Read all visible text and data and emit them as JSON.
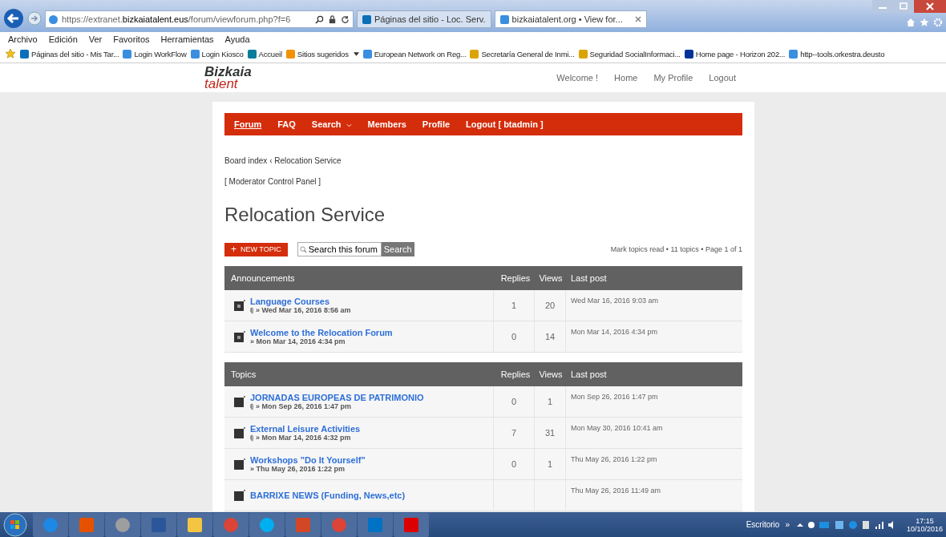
{
  "browser": {
    "address": "https://extranet.**bizkaiatalent.eus**/forum/viewforum.php?f=6",
    "tabs": [
      {
        "title": "Páginas del sitio - Loc. Serv.",
        "selected": false,
        "kind": "sharepoint"
      },
      {
        "title": "bizkaiatalent.org • View for...",
        "selected": true,
        "kind": "ie"
      }
    ],
    "menu": [
      "Archivo",
      "Edición",
      "Ver",
      "Favoritos",
      "Herramientas",
      "Ayuda"
    ],
    "favorites": [
      {
        "label": "Páginas del sitio - Mis Tar...",
        "kind": "sharepoint",
        "has_menu": false
      },
      {
        "label": "Login WorkFlow",
        "kind": "ie",
        "has_menu": false
      },
      {
        "label": "Login Kiosco",
        "kind": "ie",
        "has_menu": false
      },
      {
        "label": "Accueil",
        "kind": "circle",
        "has_menu": false
      },
      {
        "label": "Sitios sugeridos",
        "kind": "suggested",
        "has_menu": true
      },
      {
        "label": "European Network on Reg...",
        "kind": "ie",
        "has_menu": false
      },
      {
        "label": "Secretaría General de Inmi...",
        "kind": "flag",
        "has_menu": false
      },
      {
        "label": "Seguridad SocialInformaci...",
        "kind": "flag",
        "has_menu": false
      },
      {
        "label": "Home page - Horizon 202...",
        "kind": "eu",
        "has_menu": false
      },
      {
        "label": "http--tools.orkestra.deusto",
        "kind": "ie",
        "has_menu": false
      }
    ]
  },
  "site": {
    "logo": {
      "line1": "Bizkaia",
      "line2": "talent"
    },
    "links": [
      "Welcome !",
      "Home",
      "My Profile",
      "Logout"
    ]
  },
  "nav": [
    {
      "label": "Forum",
      "selected": true,
      "dropdown": false
    },
    {
      "label": "FAQ",
      "selected": false,
      "dropdown": false
    },
    {
      "label": "Search",
      "selected": false,
      "dropdown": true
    },
    {
      "label": "Members",
      "selected": false,
      "dropdown": false
    },
    {
      "label": "Profile",
      "selected": false,
      "dropdown": false
    },
    {
      "label": "Logout [ btadmin ]",
      "selected": false,
      "dropdown": false
    }
  ],
  "breadcrumb": "Board index ‹ Relocation Service",
  "moderator_link": "[ Moderator Control Panel ]",
  "title": "Relocation Service",
  "new_topic": {
    "icon": "+",
    "label": "NEW TOPIC"
  },
  "search": {
    "placeholder": "Search this forum",
    "button": "Search"
  },
  "pagination": "Mark topics read • 11 topics • Page 1 of 1",
  "sections": [
    {
      "heading": "Announcements",
      "columns": [
        "Replies",
        "Views",
        "Last post"
      ],
      "rows": [
        {
          "kind": "announcement",
          "title": "Language Courses",
          "attachment": true,
          "meta": "» Wed Mar 16, 2016 8:56 am",
          "replies": "1",
          "views": "20",
          "last_post": "Wed Mar 16, 2016 9:03 am"
        },
        {
          "kind": "announcement",
          "title": "Welcome to the Relocation Forum",
          "attachment": false,
          "meta": "» Mon Mar 14, 2016 4:34 pm",
          "replies": "0",
          "views": "14",
          "last_post": "Mon Mar 14, 2016 4:34 pm"
        }
      ]
    },
    {
      "heading": "Topics",
      "columns": [
        "Replies",
        "Views",
        "Last post"
      ],
      "rows": [
        {
          "kind": "topic",
          "title": "JORNADAS EUROPEAS DE PATRIMONIO",
          "attachment": true,
          "meta": "» Mon Sep 26, 2016 1:47 pm",
          "replies": "0",
          "views": "1",
          "last_post": "Mon Sep 26, 2016 1:47 pm"
        },
        {
          "kind": "topic",
          "title": "External Leisure Activities",
          "attachment": true,
          "meta": "» Mon Mar 14, 2016 4:32 pm",
          "replies": "7",
          "views": "31",
          "last_post": "Mon May 30, 2016 10:41 am"
        },
        {
          "kind": "topic",
          "title": "Workshops \"Do It Yourself\"",
          "attachment": false,
          "meta": "» Thu May 26, 2016 1:22 pm",
          "replies": "0",
          "views": "1",
          "last_post": "Thu May 26, 2016 1:22 pm"
        },
        {
          "kind": "topic",
          "title": "BARRIXE NEWS (Funding, News,etc)",
          "last_post": "Thu May 26, 2016 11:49 am"
        }
      ]
    }
  ],
  "taskbar": {
    "desktop_label": "Escritorio",
    "expand": "»",
    "time": "17:15",
    "date": "10/10/2016"
  }
}
